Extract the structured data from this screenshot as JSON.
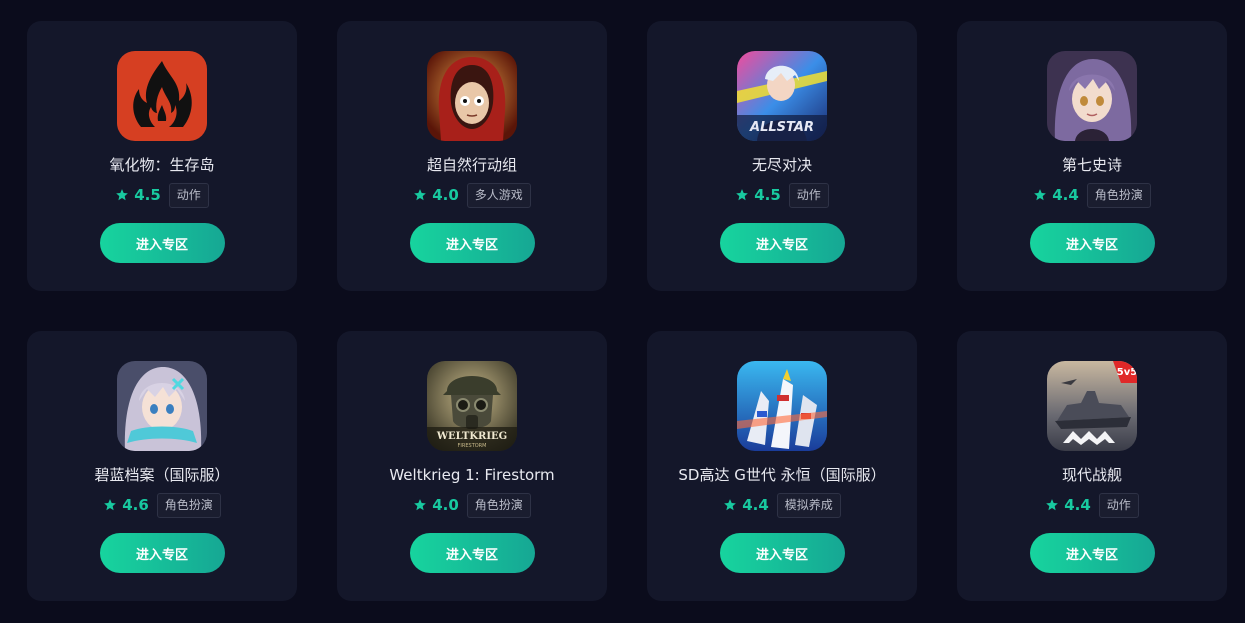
{
  "games": [
    {
      "name": "氧化物：生存岛",
      "rating": "4.5",
      "tag": "动作",
      "icon": "flame-icon",
      "button": "进入专区"
    },
    {
      "name": "超自然行动组",
      "rating": "4.0",
      "tag": "多人游戏",
      "icon": "hooded-girl-icon",
      "button": "进入专区"
    },
    {
      "name": "无尽对决",
      "rating": "4.5",
      "tag": "动作",
      "icon": "allstar-icon",
      "icon_text": "ALLSTAR",
      "button": "进入专区"
    },
    {
      "name": "第七史诗",
      "rating": "4.4",
      "tag": "角色扮演",
      "icon": "anime-girl-purple-icon",
      "button": "进入专区"
    },
    {
      "name": "碧蓝档案（国际服）",
      "rating": "4.6",
      "tag": "角色扮演",
      "icon": "anime-girl-silver-icon",
      "button": "进入专区"
    },
    {
      "name": "Weltkrieg 1: Firestorm",
      "rating": "4.0",
      "tag": "角色扮演",
      "icon": "gas-mask-soldier-icon",
      "icon_text": "WELTKRIEG",
      "icon_subtext": "FIRESTORM",
      "button": "进入专区"
    },
    {
      "name": "SD高达 G世代 永恒（国际服）",
      "rating": "4.4",
      "tag": "模拟养成",
      "icon": "gundam-icon",
      "button": "进入专区"
    },
    {
      "name": "现代战舰",
      "rating": "4.4",
      "tag": "动作",
      "icon": "warship-icon",
      "icon_badge": "5v5",
      "button": "进入专区"
    }
  ],
  "colors": {
    "background": "#0b0c1c",
    "card": "#14172a",
    "accent": "#18c9a0",
    "button_start": "#17d49e",
    "button_end": "#16a794"
  }
}
